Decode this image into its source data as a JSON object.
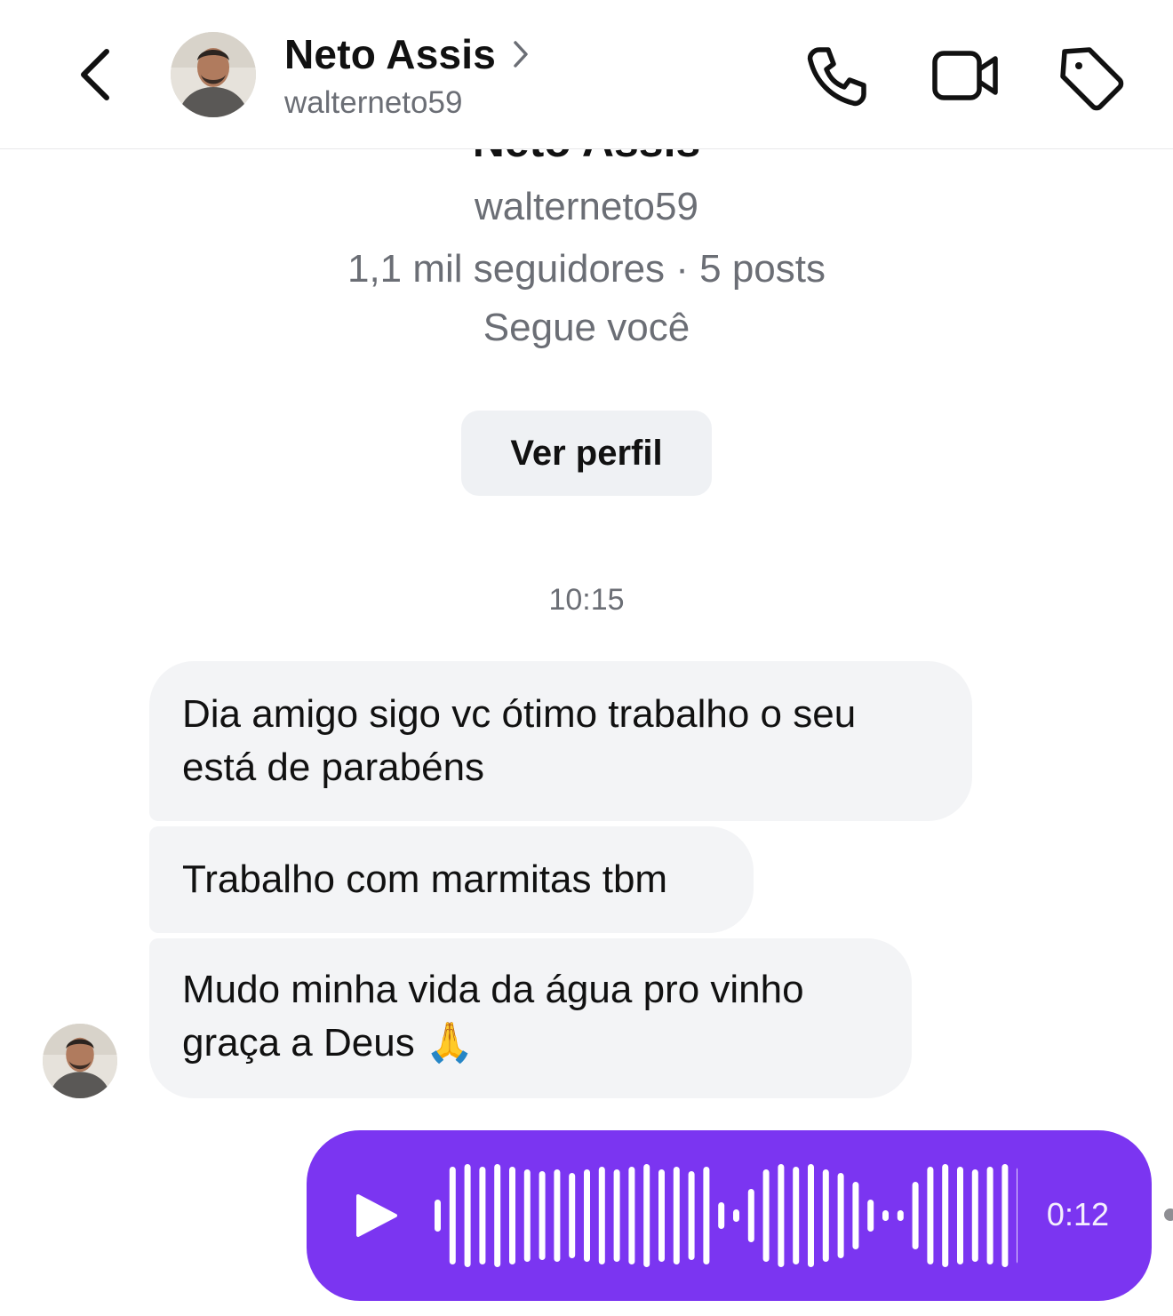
{
  "header": {
    "name": "Neto Assis",
    "username": "walterneto59",
    "icons": [
      "back-chevron-icon",
      "chevron-right-icon",
      "phone-icon",
      "video-camera-icon",
      "tag-icon"
    ]
  },
  "profile": {
    "name": "Neto Assis",
    "username": "walterneto59",
    "stats": "1,1 mil seguidores · 5 posts",
    "follows_you": "Segue você",
    "view_profile_label": "Ver perfil"
  },
  "conversation": {
    "timestamp": "10:15",
    "messages": [
      {
        "text": "Dia amigo sigo vc ótimo trabalho o seu está de parabéns"
      },
      {
        "text": "Trabalho com marmitas tbm"
      },
      {
        "text": "Mudo minha vida da água pro vinho graça a Deus 🙏"
      }
    ],
    "audio": {
      "duration": "0:12",
      "icon": "play-icon"
    }
  },
  "colors": {
    "accent": "#7b35f1",
    "bubble_bg": "#f3f4f6",
    "button_bg": "#eff1f4",
    "muted_text": "#6b6e75"
  }
}
